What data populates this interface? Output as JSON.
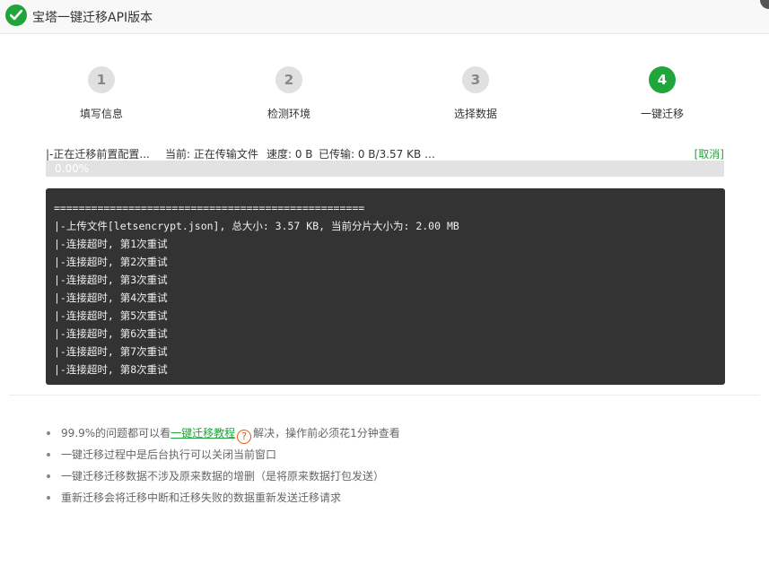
{
  "title": "宝塔一键迁移API版本",
  "steps": [
    {
      "number": "1",
      "label": "填写信息",
      "active": false
    },
    {
      "number": "2",
      "label": "检测环境",
      "active": false
    },
    {
      "number": "3",
      "label": "选择数据",
      "active": false
    },
    {
      "number": "4",
      "label": "一键迁移",
      "active": true
    }
  ],
  "status": {
    "task": "|-正在迁移前置配置...",
    "current": "当前: 正在传输文件",
    "speed": "速度: 0 B",
    "transferred": "已传输: 0 B/3.57 KB …",
    "cancel_label": "[取消]"
  },
  "progress": {
    "value": 0.0,
    "label": "0.00%"
  },
  "console_lines": [
    "==================================================",
    "|-上传文件[letsencrypt.json], 总大小: 3.57 KB, 当前分片大小为: 2.00 MB",
    "|-连接超时, 第1次重试",
    "|-连接超时, 第2次重试",
    "|-连接超时, 第3次重试",
    "|-连接超时, 第4次重试",
    "|-连接超时, 第5次重试",
    "|-连接超时, 第6次重试",
    "|-连接超时, 第7次重试",
    "|-连接超时, 第8次重试"
  ],
  "notes": {
    "note1_prefix": "99.9%的问题都可以看",
    "note1_link": "一键迁移教程",
    "help_icon": "question-circle-icon",
    "help_symbol": "?",
    "note1_suffix": "解决，操作前必须花1分钟查看",
    "note2": "一键迁移过程中是后台执行可以关闭当前窗口",
    "note3": "一键迁移迁移数据不涉及原来数据的增删（是将原来数据打包发送）",
    "note4": "重新迁移会将迁移中断和迁移失败的数据重新发送迁移请求"
  },
  "colors": {
    "accent": "#20a53a",
    "console_bg": "#333333",
    "help": "#e8590c"
  }
}
